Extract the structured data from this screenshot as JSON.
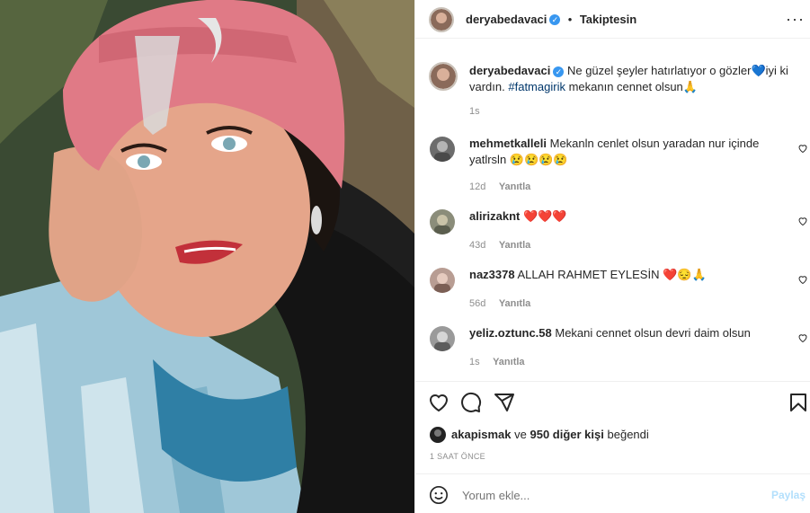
{
  "post": {
    "author": "deryabedavaci",
    "follow_status": "Takiptesin",
    "caption_text_1": "Ne güzel şeyler hatırlatıyor o gözler",
    "caption_emoji_1": "💙",
    "caption_text_2": "iyi ki vardın.",
    "hashtag": "#fatmagirik",
    "caption_text_3": "mekanın cennet olsun",
    "caption_emoji_2": "🙏",
    "caption_time": "1s"
  },
  "comments": [
    {
      "user": "mehmetkalleli",
      "text": "Mekanln cenlet olsun yaradan nur içinde yatlrsln",
      "emoji": "😢😢😢😢",
      "time": "12d",
      "reply": "Yanıtla"
    },
    {
      "user": "alirizaknt",
      "text": "",
      "emoji": "❤️❤️❤️",
      "time": "43d",
      "reply": "Yanıtla"
    },
    {
      "user": "naz3378",
      "text": "ALLAH RAHMET EYLESİN",
      "emoji": "❤️😔🙏",
      "time": "56d",
      "reply": "Yanıtla"
    },
    {
      "user": "yeliz.oztunc.58",
      "text": "Mekani cennet olsun devri daim olsun",
      "emoji": "",
      "time": "1s",
      "reply": "Yanıtla"
    }
  ],
  "likes": {
    "user": "akapismak",
    "connector": "ve",
    "others": "950 diğer kişi",
    "suffix": "beğendi"
  },
  "timestamp": "1 SAAT ÖNCE",
  "comment_input": {
    "placeholder": "Yorum ekle...",
    "post_label": "Paylaş"
  },
  "colors": {
    "accent": "#0095f6",
    "verified": "#3897f0",
    "hashtag": "#00376b"
  }
}
